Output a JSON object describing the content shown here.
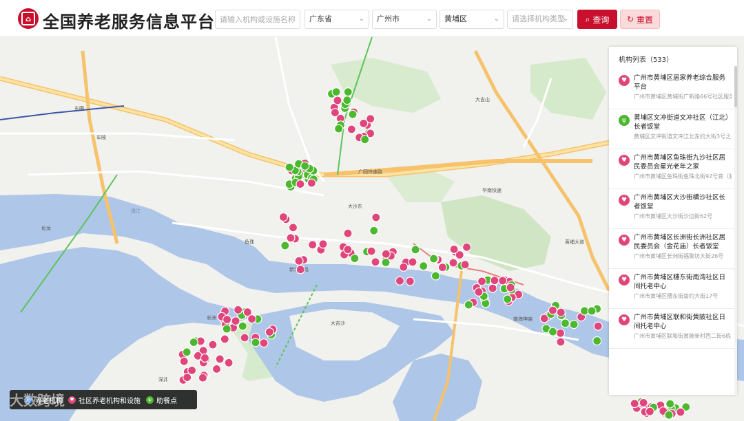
{
  "header": {
    "title": "全国养老服务信息平台",
    "search_placeholder": "请输入机构或设施名称",
    "province": "广东省",
    "city": "广州市",
    "district": "黄埔区",
    "type_placeholder": "请选择机构类型",
    "query_label": "查询",
    "reset_label": "重置"
  },
  "colors": {
    "brand": "#c8102e",
    "institution": "#e0457b",
    "community": "#e0457b",
    "meal": "#4cb82e"
  },
  "panel": {
    "title": "机构列表（533）",
    "items": [
      {
        "name": "广州市黄埔区居家养老综合服务平台",
        "addr": "广州市黄埔区黄埔街广新路66号社区服务中心3楼326室",
        "type": "pink"
      },
      {
        "name": "黄埔区文冲街道文冲社区（江北）长者饭堂",
        "addr": "黄埔区文冲街道文冲江北东约大街3号之",
        "type": "green"
      },
      {
        "name": "广州市黄埔区鱼珠街九沙社区居民委员会星光老年之家",
        "addr": "广州市黄埔区鱼珠街鱼珠北街92号旁（临时点）",
        "type": "pink"
      },
      {
        "name": "广州市黄埔区大沙街横沙社区长者饭堂",
        "addr": "广州市黄埔区大沙街沙边街62号",
        "type": "pink"
      },
      {
        "name": "广州市黄埔区长洲街长洲社区居民委员会（金花庙）长者饭堂",
        "addr": "广州市黄埔区长洲街福聚坊大街26号",
        "type": "pink"
      },
      {
        "name": "广州市黄埔区穗东街南湾社区日间托老中心",
        "addr": "广州市黄埔区穗东街南约大街17号",
        "type": "pink"
      },
      {
        "name": "广州市黄埔区联和街黄陂社区日间托老中心",
        "addr": "广州市黄埔区联和街黄陂新村西二街6栋",
        "type": "pink"
      }
    ]
  },
  "legend": {
    "institution": "养老机构",
    "community": "社区养老机构和设施",
    "meal": "助餐点"
  },
  "watermark": "大数跨境",
  "map_labels": [
    "广园快速路",
    "珠江",
    "黄埔大道",
    "大沙东",
    "车陂",
    "东圃",
    "华南快速",
    "南海神庙",
    "长洲",
    "大吉沙",
    "深井",
    "大吉山",
    "鱼珠",
    "新港东路",
    "化龙"
  ],
  "markers": {
    "pink_count": 150,
    "green_count": 90
  }
}
